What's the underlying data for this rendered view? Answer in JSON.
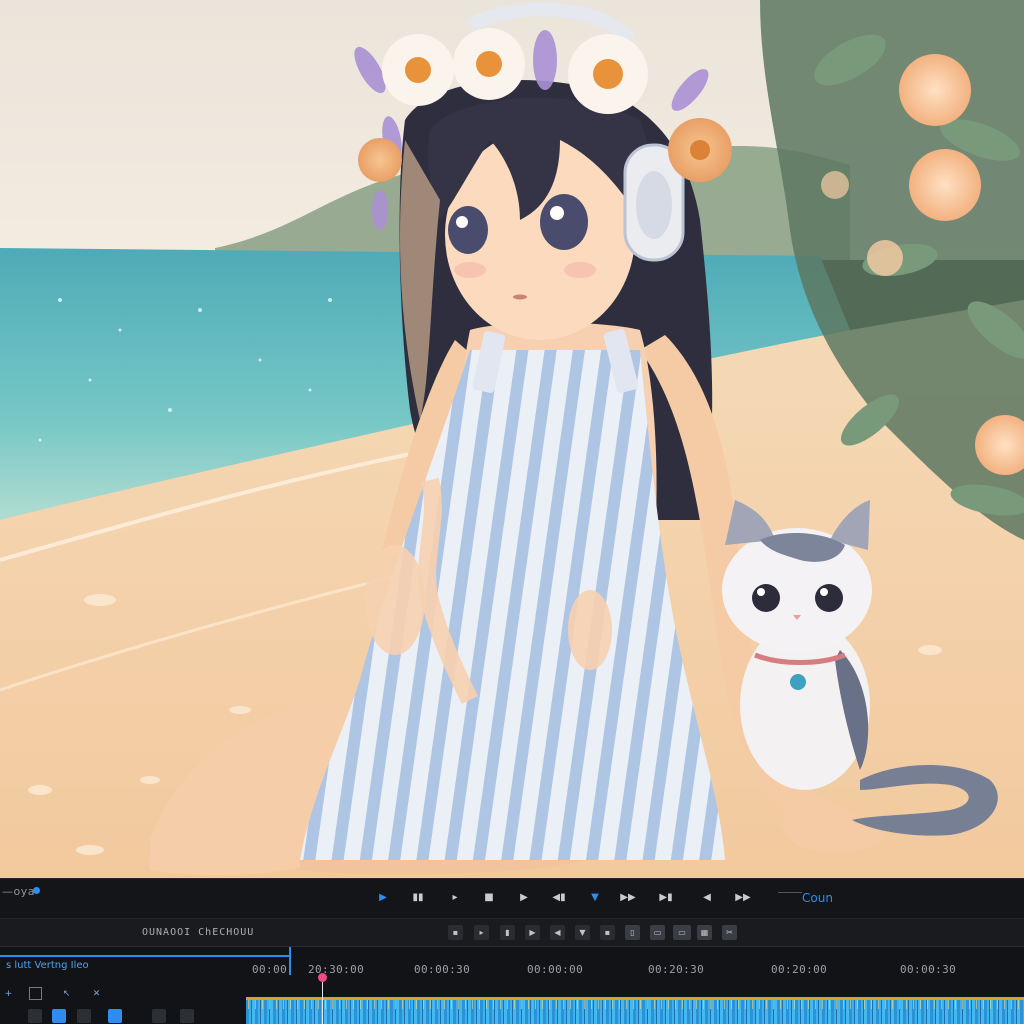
{
  "transport": {
    "left_label": "—oya",
    "right_label": "Coun",
    "controls": [
      "play-icon",
      "stop-icon",
      "step-forward-icon",
      "frame-icon",
      "play-icon",
      "rewind-icon",
      "marker-icon",
      "fast-forward-icon",
      "play-forward-icon",
      "back-icon",
      "next-icon"
    ]
  },
  "toolbar": {
    "left_text": "OUNAOOI   ChECHOUU",
    "tools": [
      "arrow-tool-icon",
      "razor-tool-icon",
      "hand-tool-icon",
      "slip-tool-icon",
      "marker-tool-icon",
      "document-icon",
      "frame-tool-icon",
      "grid-tool-icon",
      "cut-tool-icon"
    ]
  },
  "timeline": {
    "sequence_label": "s lutt Vertng Ileo",
    "timecodes": [
      "00:00",
      "20:30:00",
      "00:00:30",
      "00:00:00",
      "00:20:30",
      "00:20:00",
      "00:00:30"
    ],
    "side_tools": [
      "plus-icon",
      "square-icon",
      "cursor-icon",
      "close-icon"
    ],
    "playhead_position": 0.1
  },
  "colors": {
    "accent": "#2f8cf0",
    "playhead": "#f04a86",
    "audio_track": "#3db1ef",
    "track_highlight": "#d6a229"
  }
}
